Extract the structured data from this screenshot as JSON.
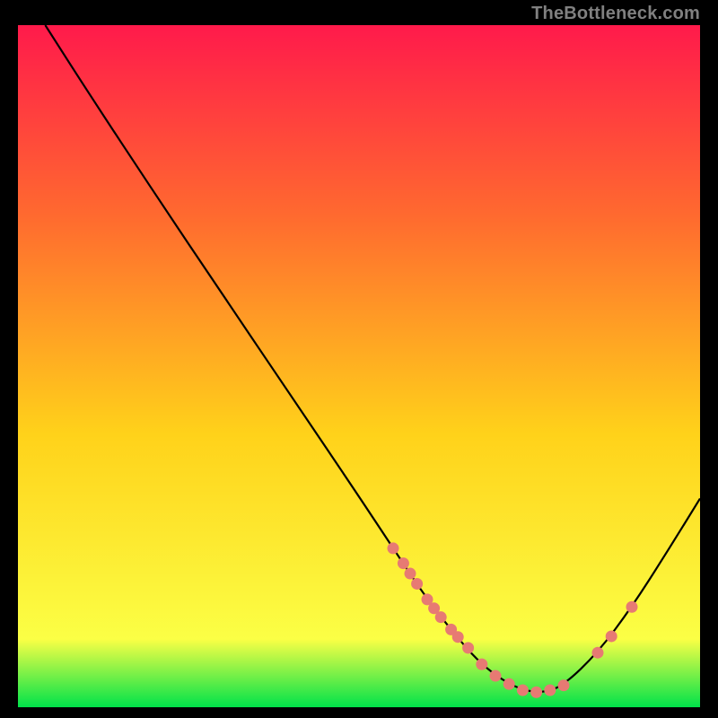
{
  "watermark": "TheBottleneck.com",
  "colors": {
    "gradient_top": "#ff1a4b",
    "gradient_mid1": "#ff6a2f",
    "gradient_mid2": "#ffd21a",
    "gradient_mid3": "#fbff45",
    "gradient_bottom": "#00e24a",
    "curve": "#000000",
    "points": "#e77a73",
    "frame": "#000000"
  },
  "chart_data": {
    "type": "line",
    "title": "",
    "xlabel": "",
    "ylabel": "",
    "xlim": [
      0,
      100
    ],
    "ylim": [
      0,
      100
    ],
    "series": [
      {
        "name": "bottleneck-curve",
        "x": [
          4,
          10,
          20,
          30,
          40,
          50,
          55,
          60,
          65,
          68,
          71,
          74,
          77,
          80,
          85,
          90,
          95,
          100
        ],
        "y": [
          100,
          90.6,
          75.4,
          60.5,
          45.7,
          30.9,
          23.3,
          15.8,
          9.5,
          6.3,
          4.0,
          2.5,
          2.1,
          3.2,
          8.0,
          14.7,
          22.5,
          30.6
        ]
      }
    ],
    "scatter": [
      {
        "name": "highlight-points",
        "x": [
          55,
          56.5,
          57.5,
          58.5,
          60,
          61,
          62,
          63.5,
          64.5,
          66,
          68,
          70,
          72,
          74,
          76,
          78,
          80,
          85,
          87,
          90
        ],
        "y": [
          23.3,
          21.1,
          19.6,
          18.1,
          15.8,
          14.5,
          13.2,
          11.4,
          10.3,
          8.7,
          6.3,
          4.6,
          3.4,
          2.5,
          2.2,
          2.5,
          3.2,
          8.0,
          10.4,
          14.7
        ]
      }
    ]
  }
}
